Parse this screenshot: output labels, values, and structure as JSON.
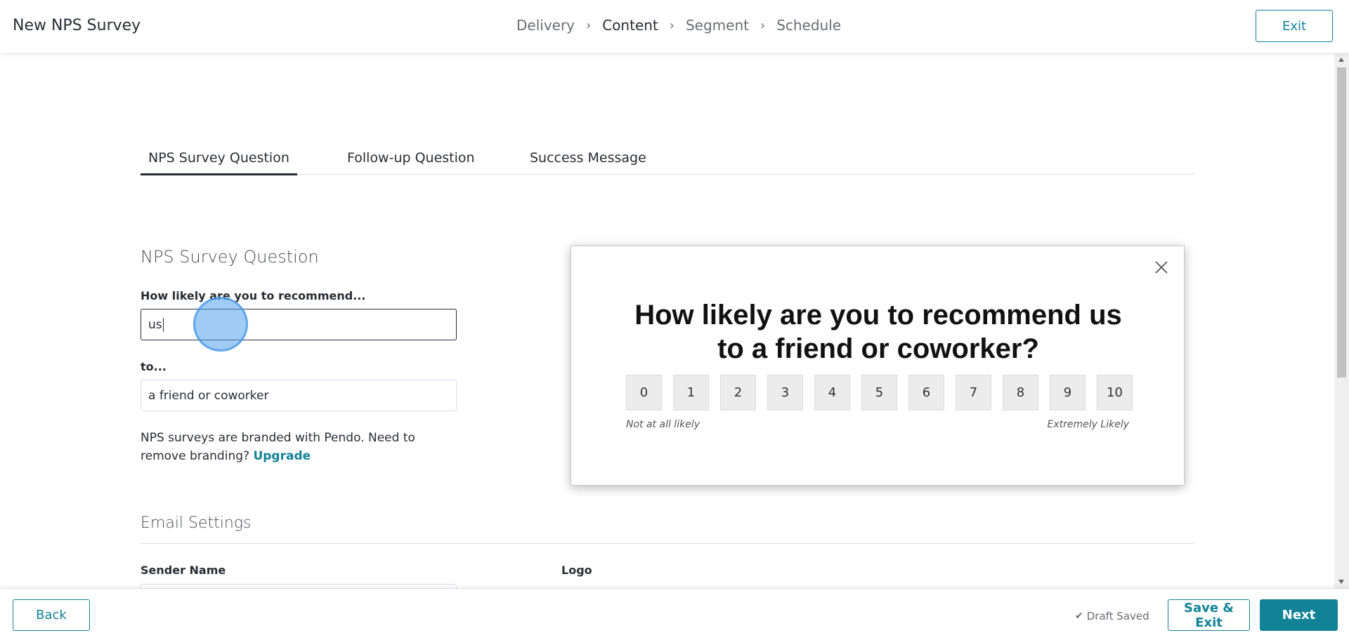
{
  "header": {
    "title": "New NPS Survey",
    "steps": [
      "Delivery",
      "Content",
      "Segment",
      "Schedule"
    ],
    "exit_label": "Exit"
  },
  "tabs": [
    "NPS Survey Question",
    "Follow-up Question",
    "Success Message"
  ],
  "form": {
    "section_title": "NPS Survey Question",
    "recommend_label": "How likely are you to recommend...",
    "recommend_value": "us",
    "to_label": "to...",
    "to_value": "a friend or coworker",
    "branding_text": "NPS surveys are branded with Pendo. Need to remove branding?",
    "upgrade_label": "Upgrade"
  },
  "email_settings": {
    "title": "Email Settings",
    "sender_label": "Sender Name",
    "logo_label": "Logo"
  },
  "preview": {
    "question_line1": "How likely are you to recommend us",
    "question_line2": "to a friend or coworker?",
    "scores": [
      "0",
      "1",
      "2",
      "3",
      "4",
      "5",
      "6",
      "7",
      "8",
      "9",
      "10"
    ],
    "low_label": "Not at all likely",
    "high_label": "Extremely Likely"
  },
  "footer": {
    "back_label": "Back",
    "draft_status": "Draft Saved",
    "save_exit_label": "Save & Exit",
    "next_label": "Next"
  },
  "colors": {
    "accent": "#128297",
    "text": "#2a2c35"
  }
}
